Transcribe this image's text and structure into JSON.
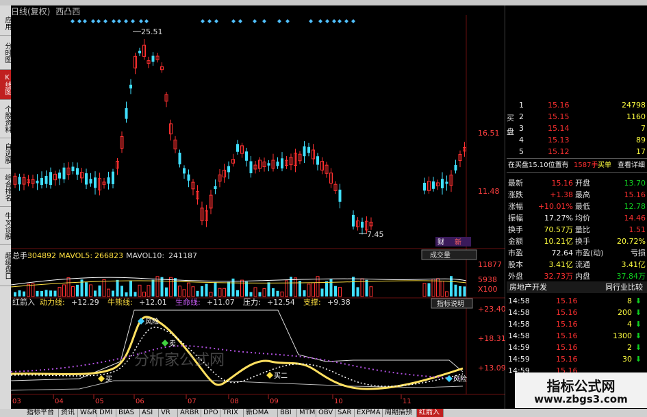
{
  "header": {
    "title": "日线(复权)",
    "name": "西凸西"
  },
  "left_tabs": [
    {
      "label": "应用",
      "active": false
    },
    {
      "label": "分时图",
      "active": false
    },
    {
      "label": "K线图",
      "active": true
    },
    {
      "label": "个股资料",
      "active": false
    },
    {
      "label": "自选股",
      "active": false
    },
    {
      "label": "综合排名",
      "active": false
    },
    {
      "label": "牛叉诊股",
      "active": false
    },
    {
      "label": "超级盘口",
      "active": false
    }
  ],
  "price_chart": {
    "high_label": "25.51",
    "low_label": "7.45",
    "right_ticks": [
      "16.51",
      "11.48"
    ],
    "tag": "财",
    "tag2": "新"
  },
  "volume_panel": {
    "total_label": "总手:",
    "total_value": "304892",
    "mavol5_label": "MAVOL5:",
    "mavol5_value": "266823",
    "mavol10_label": "MAVOL10:",
    "mavol10_value": "241187",
    "dropdown": "成交量",
    "ticks": [
      "11877",
      "5938",
      "X100"
    ]
  },
  "indicator_panel": {
    "name": "红箭入",
    "items": [
      {
        "label": "动力线:",
        "value": "+12.29"
      },
      {
        "label": "牛熊线:",
        "value": "+12.01"
      },
      {
        "label": "生命线:",
        "value": "+11.07"
      },
      {
        "label": "压力:",
        "value": "+12.54"
      },
      {
        "label": "支撑:",
        "value": "+9.38"
      }
    ],
    "help_button": "指标说明",
    "ticks": [
      "+23.40",
      "+18.31",
      "+13.09"
    ],
    "annotations": [
      "风险",
      "卖",
      "买",
      "买二",
      "风险"
    ],
    "watermark": "分析家公式网"
  },
  "x_axis": [
    "03",
    "04",
    "05",
    "06",
    "07",
    "08",
    "09",
    "10",
    "11"
  ],
  "order_book": {
    "buy_label": "买盘",
    "sell_label": "买",
    "rows": [
      {
        "n": "1",
        "price": "15.16",
        "vol": "24798"
      },
      {
        "n": "2",
        "price": "15.15",
        "vol": "1160"
      },
      {
        "n": "3",
        "price": "15.14",
        "vol": "7"
      },
      {
        "n": "4",
        "price": "15.13",
        "vol": "89"
      },
      {
        "n": "5",
        "price": "15.12",
        "vol": "17"
      }
    ]
  },
  "buy_queue": {
    "text": "在买盘15.10位置有",
    "count": "1587手",
    "btn": "买单",
    "detail": "查看详细"
  },
  "quote": [
    {
      "l1": "最新",
      "v1": "15.16",
      "c1": "red",
      "l2": "开盘",
      "v2": "13.70",
      "c2": "green"
    },
    {
      "l1": "涨跌",
      "v1": "+1.38",
      "c1": "red",
      "l2": "最高",
      "v2": "15.16",
      "c2": "red"
    },
    {
      "l1": "涨幅",
      "v1": "+10.01%",
      "c1": "red",
      "l2": "最低",
      "v2": "12.78",
      "c2": "green"
    },
    {
      "l1": "振幅",
      "v1": "17.27%",
      "c1": "white",
      "l2": "均价",
      "v2": "14.46",
      "c2": "red"
    },
    {
      "l1": "换手",
      "v1": "70.57万",
      "c1": "yellow",
      "l2": "量比",
      "v2": "1.51",
      "c2": "red"
    },
    {
      "l1": "金额",
      "v1": "10.21亿",
      "c1": "yellow",
      "l2": "换手",
      "v2": "20.72%",
      "c2": "yellow"
    },
    {
      "l1": "市盈",
      "v1": "72.64",
      "c1": "white",
      "l2": "市盈(动)",
      "v2": "亏损",
      "c2": "white"
    },
    {
      "l1": "股本",
      "v1": "3.41亿",
      "c1": "yellow",
      "l2": "流通",
      "v2": "3.41亿",
      "c2": "yellow"
    },
    {
      "l1": "外盘",
      "v1": "32.73万",
      "c1": "red",
      "l2": "内盘",
      "v2": "37.84万",
      "c2": "green"
    }
  ],
  "industry": {
    "name": "房地产开发",
    "compare": "同行业比较"
  },
  "ticks": [
    {
      "time": "14:58",
      "price": "15.16",
      "vol": "8",
      "dir": "down"
    },
    {
      "time": "14:58",
      "price": "15.16",
      "vol": "200",
      "dir": "down"
    },
    {
      "time": "14:58",
      "price": "15.16",
      "vol": "4",
      "dir": "down"
    },
    {
      "time": "14:58",
      "price": "15.16",
      "vol": "1300",
      "dir": "down"
    },
    {
      "time": "14:59",
      "price": "15.16",
      "vol": "2",
      "dir": "down"
    },
    {
      "time": "14:59",
      "price": "15.16",
      "vol": "30",
      "dir": "down"
    },
    {
      "time": "14:59",
      "price": "15.16",
      "vol": "",
      "dir": ""
    }
  ],
  "bottom_tabs": [
    {
      "label": "指标平台",
      "active": false
    },
    {
      "label": "资讯",
      "active": false
    },
    {
      "label": "W&R",
      "active": false
    },
    {
      "label": "DMI",
      "active": false
    },
    {
      "label": "BIAS",
      "active": false
    },
    {
      "label": "ASI",
      "active": false
    },
    {
      "label": "VR",
      "active": false
    },
    {
      "label": "ARBR",
      "active": false
    },
    {
      "label": "DPO",
      "active": false
    },
    {
      "label": "TRIX",
      "active": false
    },
    {
      "label": "新DMA",
      "active": false
    },
    {
      "label": "BBI",
      "active": false
    },
    {
      "label": "MTM",
      "active": false
    },
    {
      "label": "OBV",
      "active": false
    },
    {
      "label": "SAR",
      "active": false
    },
    {
      "label": "EXPMA",
      "active": false
    },
    {
      "label": "周期描预",
      "active": false
    },
    {
      "label": "红箭入",
      "active": true
    }
  ],
  "site_watermark": {
    "line1": "指标公式网",
    "line2": "www.zbgs3.com"
  },
  "colors": {
    "up": "#ff3030",
    "down": "#40e0ff",
    "background": "#000000",
    "accent": "#c02020"
  }
}
